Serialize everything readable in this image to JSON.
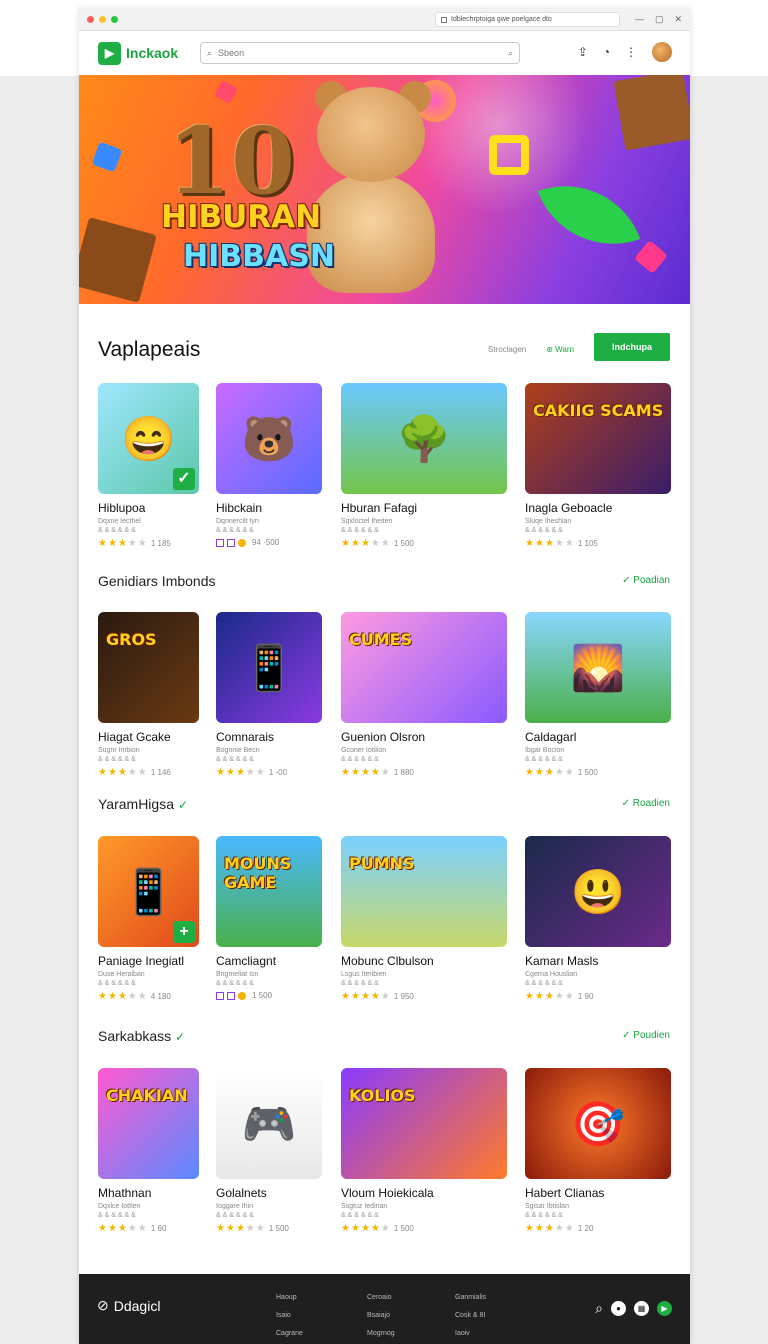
{
  "browser": {
    "url": "Idblechrptoiga gwe poelgace dto"
  },
  "header": {
    "logo_text": "Inckaok",
    "search_placeholder": "Sbeon"
  },
  "hero": {
    "number": "10",
    "title_line1": "HIBURAN",
    "title_line2": "HIBBASN"
  },
  "featured": {
    "title": "Vaplapeais",
    "filter_label": "Stroclagen",
    "toggle_label": "Warn",
    "button_label": "Indchupa",
    "items": [
      {
        "name": "Hiblupoa",
        "sub": "Dqxne Iecthel",
        "meta": "& & & & & &",
        "rating_text": "1 185",
        "stars": 3
      },
      {
        "name": "Hibckain",
        "sub": "Dqnnercilt Iyn",
        "meta": "& & & & & &",
        "rating_text": "94 ·500",
        "stars": 0
      },
      {
        "name": "Hburan Fafagi",
        "sub": "Sqxloctel Iheiten",
        "meta": "& & & & & &",
        "rating_text": "1 500",
        "stars": 2.5
      },
      {
        "name": "Inagla Geboacle",
        "sub": "Sluqe Iheshlan",
        "meta": "& & & & & &",
        "rating_text": "1 105",
        "stars": 3
      }
    ]
  },
  "sections": [
    {
      "title": "Genidiars Imbonds",
      "check": "",
      "link": "Poadian",
      "items": [
        {
          "name": "Hiagat Gcake",
          "sub": "Sugnr Imbion",
          "meta": "& & & & & &",
          "rating_text": "1 146",
          "stars": 3
        },
        {
          "name": "Comnarais",
          "sub": "Bognnie Becn",
          "meta": "& & & & & &",
          "rating_text": "1 -00",
          "stars": 2.5
        },
        {
          "name": "Guenion Olsron",
          "sub": "Gconer Iotilion",
          "meta": "& & & & & &",
          "rating_text": "1 880",
          "stars": 3.5
        },
        {
          "name": "Caldagarl",
          "sub": "Ibgar Bocion",
          "meta": "& & & & & &",
          "rating_text": "1 500",
          "stars": 3
        }
      ]
    },
    {
      "title": "YaramHigsa",
      "check": "✓",
      "link": "Roadien",
      "items": [
        {
          "name": "Paniage Inegiatl",
          "sub": "Duse Heraiban",
          "meta": "& & & & & &",
          "rating_text": "4 180",
          "stars": 3
        },
        {
          "name": "Camcliagnt",
          "sub": "Bngmeliat Isn",
          "meta": "& & & & & &",
          "rating_text": "1 500",
          "stars": 0
        },
        {
          "name": "Mobunc Clbulson",
          "sub": "Lsgus Iteribien",
          "meta": "& & & & & &",
          "rating_text": "1 950",
          "stars": 3.5
        },
        {
          "name": "Kamarı Masls",
          "sub": "Cgerna Houslian",
          "meta": "& & & & & &",
          "rating_text": "1 90",
          "stars": 3
        }
      ]
    },
    {
      "title": "Sarkabkass",
      "check": "✓",
      "link": "Poudien",
      "items": [
        {
          "name": "Mhathnan",
          "sub": "Dqxlce Iottlen",
          "meta": "& & & & & &",
          "rating_text": "1 60",
          "stars": 3
        },
        {
          "name": "Golalnets",
          "sub": "Ioggare Ihin",
          "meta": "& & & & & &",
          "rating_text": "1 500",
          "stars": 3
        },
        {
          "name": "Vloum Hoiekicala",
          "sub": "Ssgtuz Iedinan",
          "meta": "& & & & & &",
          "rating_text": "1 500",
          "stars": 3.5
        },
        {
          "name": "Habert Clianas",
          "sub": "Sgisar Ibtislan",
          "meta": "& & & & & &",
          "rating_text": "1 20",
          "stars": 3
        }
      ]
    }
  ],
  "thumbs": {
    "featured": [
      {
        "cap": "",
        "glyph": "😄",
        "bg": "linear-gradient(135deg,#9fe7ff,#5cc7a8)",
        "badge": "✓"
      },
      {
        "cap": "",
        "glyph": "🐻",
        "bg": "linear-gradient(135deg,#c86bff,#5a6bff)",
        "badge": ""
      },
      {
        "cap": "",
        "glyph": "🌳",
        "bg": "linear-gradient(180deg,#6ac8ff,#73c54a)",
        "badge": ""
      },
      {
        "cap": "CAKIIG SCAMS",
        "glyph": "",
        "bg": "linear-gradient(135deg,#b0401a,#3a1d6a)",
        "badge": ""
      }
    ],
    "s1": [
      {
        "cap": "GROS",
        "glyph": "",
        "bg": "linear-gradient(135deg,#2a1a10,#6a3a12)",
        "badge": ""
      },
      {
        "cap": "",
        "glyph": "📱",
        "bg": "linear-gradient(135deg,#1a2a8a,#8a3ae0)",
        "badge": ""
      },
      {
        "cap": "CUMES",
        "glyph": "",
        "bg": "linear-gradient(135deg,#ff9ae0,#8a5aff)",
        "badge": ""
      },
      {
        "cap": "",
        "glyph": "🌄",
        "bg": "linear-gradient(180deg,#8ad6ff,#4ab04a)",
        "badge": ""
      }
    ],
    "s2": [
      {
        "cap": "",
        "glyph": "📱",
        "bg": "linear-gradient(135deg,#ff9a2a,#e04a1a)",
        "badge": "+"
      },
      {
        "cap": "MOUNS GAME",
        "glyph": "",
        "bg": "linear-gradient(180deg,#4ab8ff,#4ab04a)",
        "badge": ""
      },
      {
        "cap": "PUMNS",
        "glyph": "",
        "bg": "linear-gradient(180deg,#7ad0ff,#c8d86a)",
        "badge": ""
      },
      {
        "cap": "",
        "glyph": "😃",
        "bg": "linear-gradient(135deg,#1a2a4a,#6a2a8a)",
        "badge": ""
      }
    ],
    "s3": [
      {
        "cap": "CHAKIAN",
        "glyph": "",
        "bg": "linear-gradient(135deg,#ff5ad0,#5a8aff)",
        "badge": ""
      },
      {
        "cap": "",
        "glyph": "🎮",
        "bg": "linear-gradient(180deg,#ffffff,#e8e8e8)",
        "badge": ""
      },
      {
        "cap": "KOLIOS",
        "glyph": "",
        "bg": "linear-gradient(135deg,#8a3aff,#ff7a2a)",
        "badge": ""
      },
      {
        "cap": "",
        "glyph": "🎯",
        "bg": "radial-gradient(circle,#ff7a2a,#8a1a0a)",
        "badge": ""
      }
    ]
  },
  "footer": {
    "logo_text": "Ddagicl",
    "col1": [
      "Haoup",
      "Isaio",
      "Cagrane"
    ],
    "col2": [
      "Ceroaio",
      "Bsaiajo",
      "Mogrnog"
    ],
    "col3": [
      "Ganmialis",
      "Cosk & 8I",
      "Iaoiv"
    ]
  },
  "colors": {
    "accent": "#1fae44",
    "footer_bg": "#1f1f1f",
    "star": "#f4b400"
  }
}
